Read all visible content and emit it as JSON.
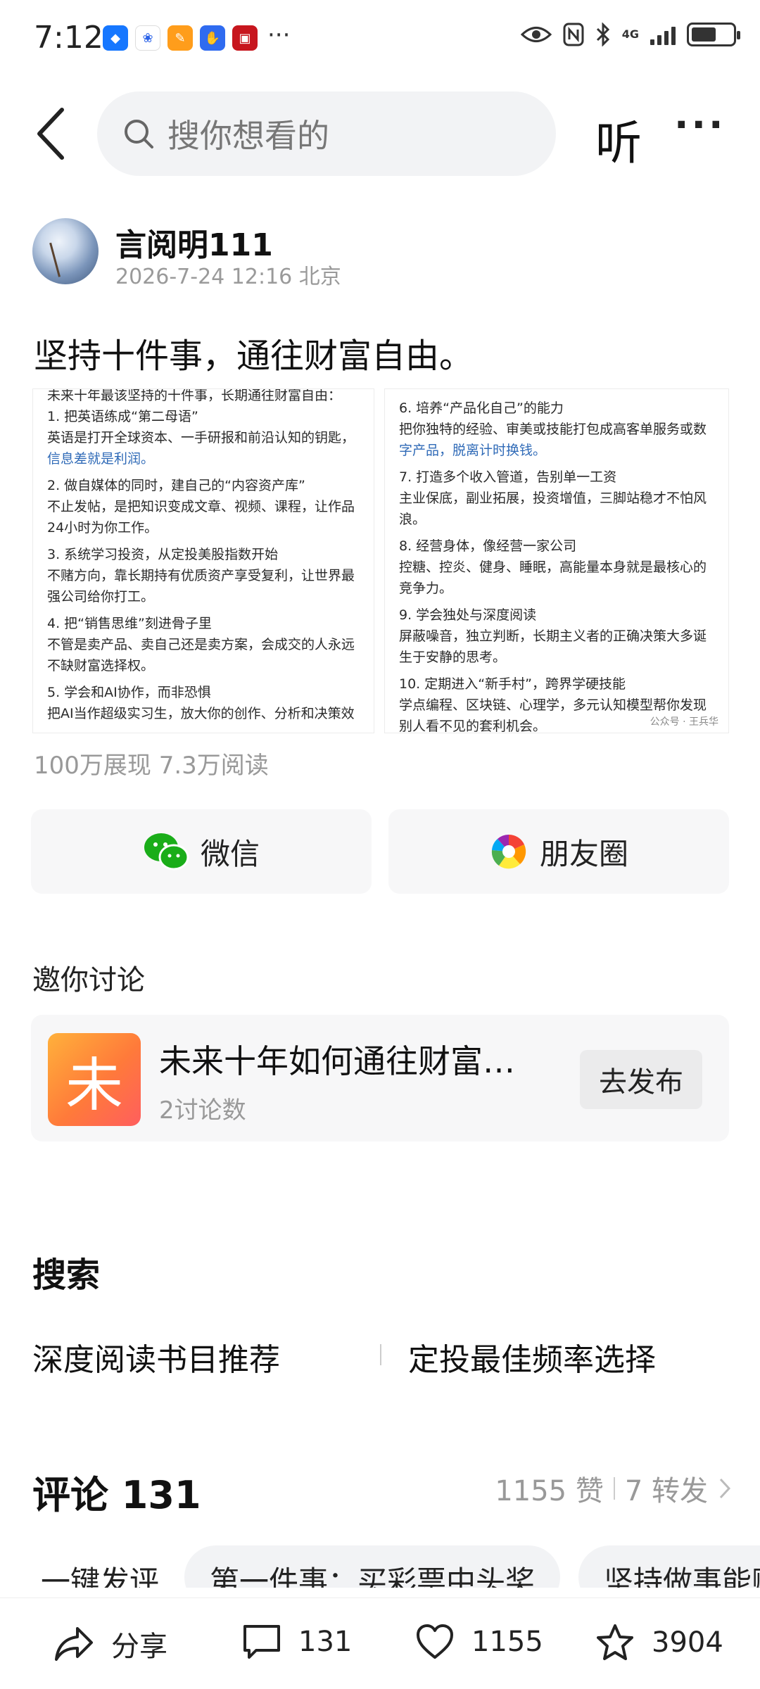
{
  "status_bar": {
    "time": "7:12",
    "more": "···",
    "network": "4G"
  },
  "nav": {
    "search_placeholder": "搜你想看的",
    "listen_label": "听",
    "more_label": "···"
  },
  "author": {
    "name": "言阅明111",
    "meta": "2026-7-24 12:16 北京"
  },
  "post": {
    "title": "坚持十件事，通往财富自由。",
    "image": {
      "left": [
        "未来十年最该坚持的十件事，长期通往财富自由：",
        "1. 把英语练成“第二母语”",
        "英语是打开全球资本、一手研报和前沿认知的钥匙，",
        "信息差就是利润。",
        "2. 做自媒体的同时，建自己的“内容资产库”",
        "不止发帖，是把知识变成文章、视频、课程，让作品",
        "24小时为你工作。",
        "3. 系统学习投资，从定投美股指数开始",
        "不赌方向，靠长期持有优质资产享受复利，让世界最",
        "强公司给你打工。",
        "4. 把“销售思维”刻进骨子里",
        "不管是卖产品、卖自己还是卖方案，会成交的人永远",
        "不缺财富选择权。",
        "5. 学会和AI协作，而非恐惧",
        "把AI当作超级实习生，放大你的创作、分析和决策效"
      ],
      "right": [
        "6. 培养“产品化自己”的能力",
        "把你独特的经验、审美或技能打包成高客单服务或数",
        "字产品，脱离计时换钱。",
        "7. 打造多个收入管道，告别单一工资",
        "主业保底，副业拓展，投资增值，三脚站稳才不怕风",
        "浪。",
        "8. 经营身体，像经营一家公司",
        "控糖、控炎、健身、睡眠，高能量本身就是最核心的",
        "竞争力。",
        "9. 学会独处与深度阅读",
        "屏蔽噪音，独立判断，长期主义者的正确决策大多诞",
        "生于安静的思考。",
        "10. 定期进入“新手村”，跨界学硬技能",
        "学点编程、区块链、心理学，多元认知模型帮你发现",
        "别人看不见的套利机会。"
      ],
      "watermark": "公众号 · 王兵华"
    },
    "stats": "100万展现   7.3万阅读"
  },
  "share": {
    "wechat": "微信",
    "moments": "朋友圈"
  },
  "discuss": {
    "heading": "邀你讨论",
    "icon_char": "未",
    "topic_title": "未来十年如何通往财富自由",
    "topic_count": "2讨论数",
    "publish_label": "去发布"
  },
  "search": {
    "heading": "搜索",
    "suggestions": [
      "深度阅读书目推荐",
      "定投最佳频率选择"
    ]
  },
  "comments": {
    "heading": "评论 131",
    "likes": "1155 赞",
    "reposts": "7 转发",
    "chips": [
      "一键发评",
      "第一件事：买彩票中头奖",
      "坚持做事能赚"
    ]
  },
  "bottom_bar": {
    "share": "分享",
    "comments": "131",
    "likes": "1155",
    "favorites": "3904"
  },
  "colors": {
    "link": "#2f6ab7",
    "wechat_green": "#1aad19",
    "accent_orange": "#ff7a3a"
  }
}
